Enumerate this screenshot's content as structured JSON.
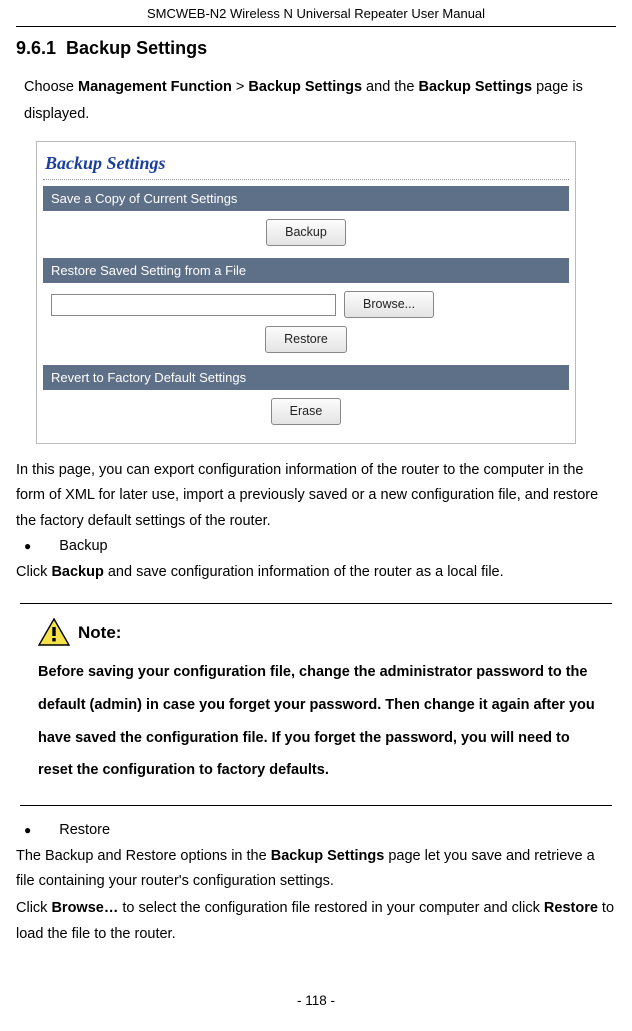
{
  "header": {
    "title": "SMCWEB-N2 Wireless N Universal Repeater User Manual"
  },
  "section": {
    "number": "9.6.1",
    "title": "Backup Settings"
  },
  "intro": {
    "pre": "Choose ",
    "b1": "Management Function",
    "gt": " > ",
    "b2": "Backup Settings",
    "mid": " and the ",
    "b3": "Backup Settings",
    "post": " page is displayed."
  },
  "ui": {
    "title": "Backup Settings",
    "sec1": "Save a Copy of Current Settings",
    "btn_backup": "Backup",
    "sec2": "Restore Saved Setting from a File",
    "btn_browse": "Browse...",
    "btn_restore": "Restore",
    "sec3": "Revert to Factory Default Settings",
    "btn_erase": "Erase"
  },
  "para1": "In this page, you can export configuration information of the router to the computer in the form of XML for later use, import a previously saved or a new configuration file, and restore the factory default settings of the router.",
  "bullet_backup": "Backup",
  "para2_pre": "Click ",
  "para2_b": "Backup",
  "para2_post": " and save configuration information of the router as a local file.",
  "note": {
    "label": "Note:",
    "body": "Before saving your configuration file, change the administrator password to the default (admin) in case you forget your password. Then change it again after you have saved the configuration file. If you forget the password, you will need to reset the configuration to factory defaults."
  },
  "bullet_restore": "Restore",
  "para3_pre": "The Backup and Restore options in the ",
  "para3_b": "Backup Settings",
  "para3_post": " page let you save and retrieve a file containing your router's configuration settings.",
  "para4_pre": "Click ",
  "para4_b1": "Browse…",
  "para4_mid": " to select the configuration file restored in your computer and click ",
  "para4_b2": "Restore",
  "para4_post": " to load the file to the router.",
  "page_number": "- 118 -"
}
